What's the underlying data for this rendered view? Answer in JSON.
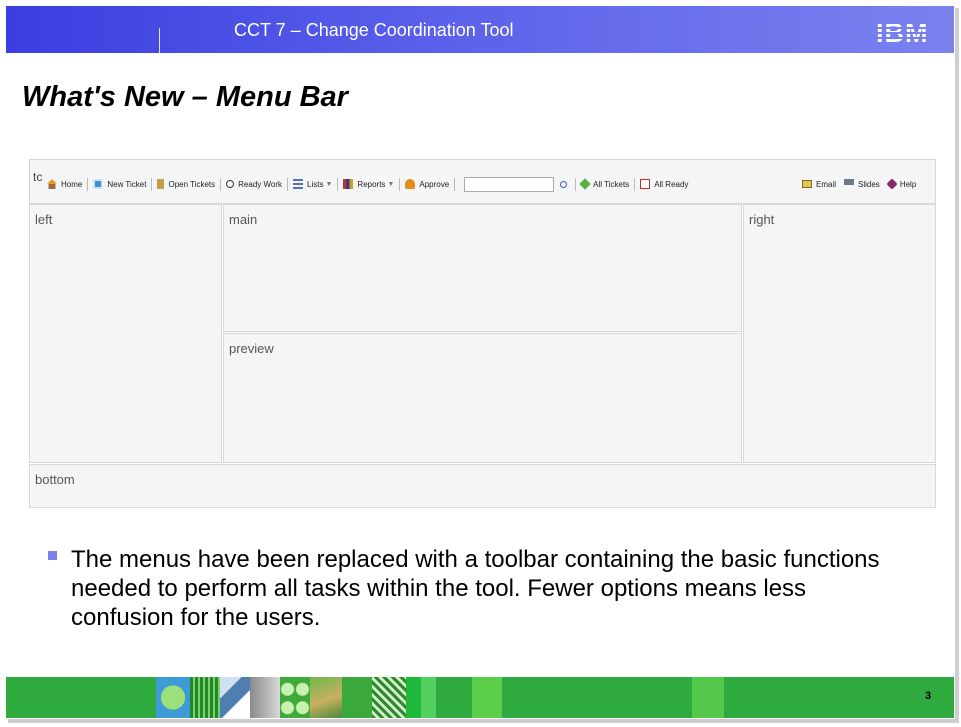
{
  "header": {
    "title": "CCT 7 – Change Coordination Tool",
    "logo_text": "IBM",
    "color": "#4a50e6"
  },
  "slide": {
    "title": "What's New – Menu Bar",
    "page_number": "3"
  },
  "app": {
    "toolbar_region_label": "tc",
    "toolbar": {
      "home": "Home",
      "new_ticket": "New Ticket",
      "open_tickets": "Open Tickets",
      "ready_work": "Ready Work",
      "lists": "Lists",
      "reports": "Reports",
      "approve": "Approve",
      "search_placeholder": "",
      "all_tickets": "All Tickets",
      "all_ready": "All Ready",
      "email": "Email",
      "slides": "Slides",
      "help": "Help"
    },
    "panels": {
      "left": "left",
      "main": "main",
      "preview": "preview",
      "right": "right",
      "bottom": "bottom"
    }
  },
  "content": {
    "bullet": "The menus have been replaced with a toolbar containing the basic functions needed to perform all tasks within the tool. Fewer options means less confusion for the users."
  },
  "colors": {
    "accent": "#4a50e6",
    "footer_green": "#2faa3f",
    "bullet": "#7b82ee"
  }
}
